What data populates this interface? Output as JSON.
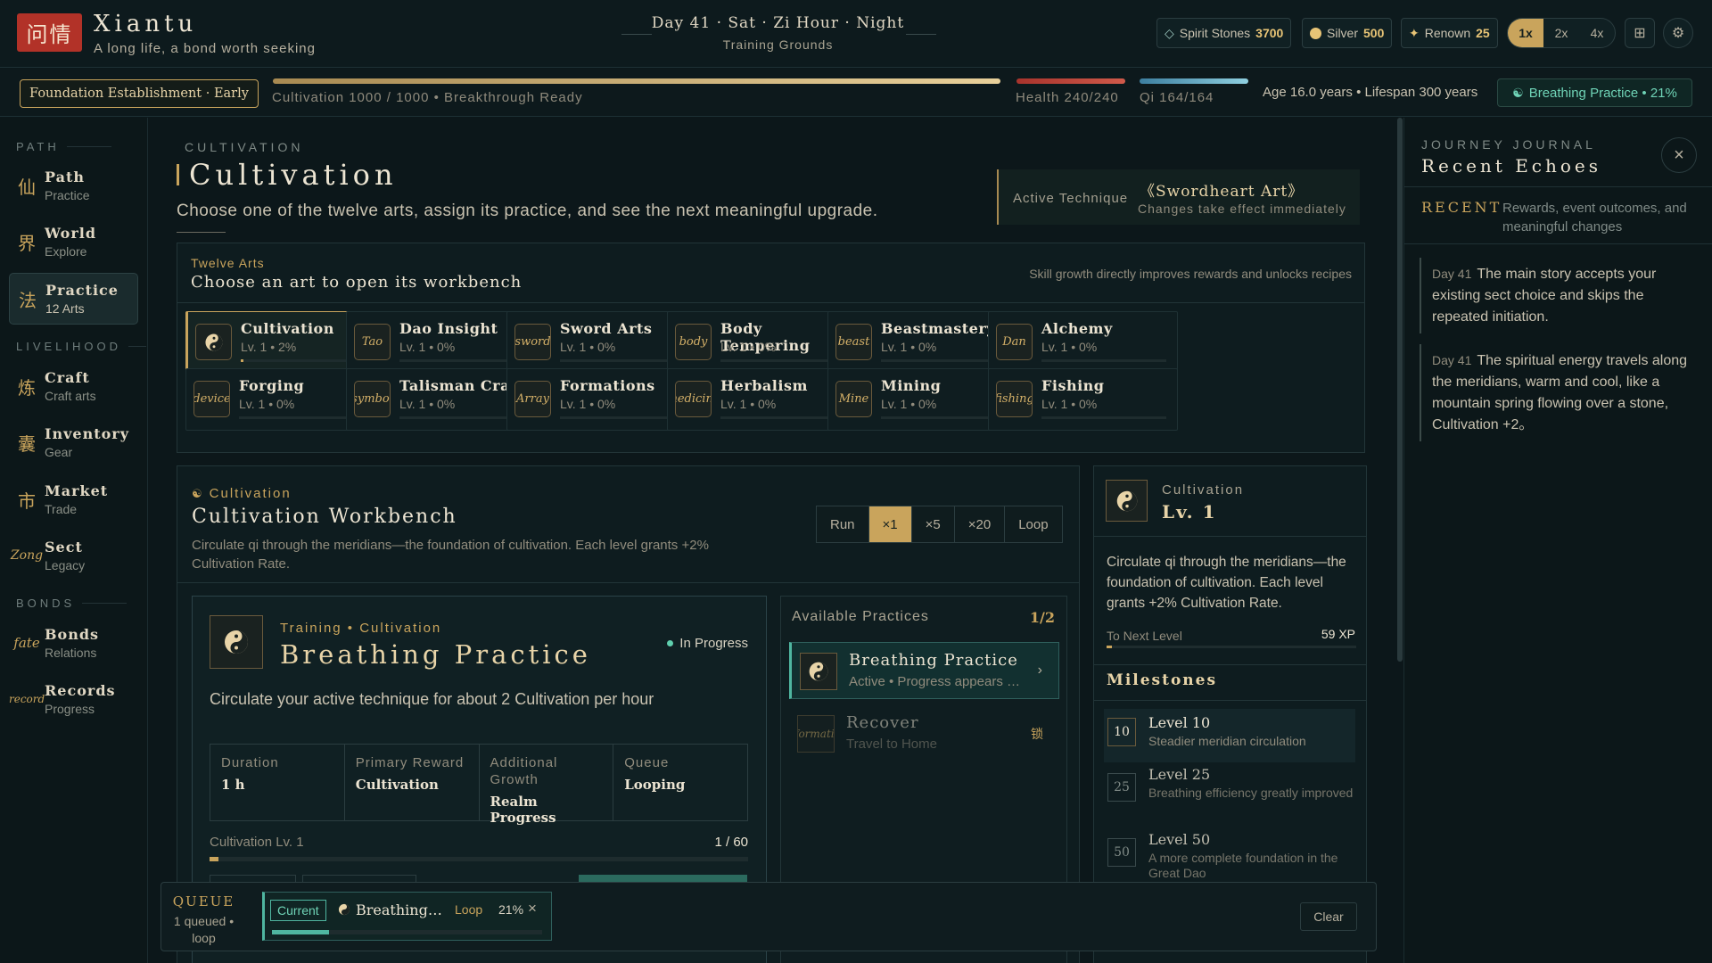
{
  "app": {
    "seal": "问情",
    "title": "Xiantu",
    "subtitle": "A long life, a bond worth seeking"
  },
  "datetime": {
    "main": "Day 41 · Sat · Zi Hour · Night",
    "location": "Training Grounds"
  },
  "resources": [
    {
      "icon": "diamond-icon",
      "label": "Spirit Stones",
      "value": "3700"
    },
    {
      "icon": "coin-icon",
      "label": "Silver",
      "value": "500"
    },
    {
      "icon": "star-icon",
      "label": "Renown",
      "value": "25"
    }
  ],
  "speed": {
    "options": [
      "1x",
      "2x",
      "4x"
    ],
    "selected": "1x"
  },
  "status": {
    "realm": "Foundation Establishment · Early",
    "cultivation_text": "Cultivation 1000 / 1000 • Breakthrough Ready",
    "cultivation_fraction": 1.0,
    "health_text": "Health 240/240",
    "health_fraction": 1.0,
    "qi_text": "Qi 164/164",
    "qi_fraction": 1.0,
    "age_text": "Age 16.0 years • Lifespan 300 years",
    "active_practice": "Breathing Practice • 21%"
  },
  "colors": {
    "accent": "#c9a45c",
    "qi": "#4fb6a0",
    "health": "#c9443a",
    "bg": "#0c171a"
  },
  "sidebar": {
    "sections": [
      "PATH",
      "LIVELIHOOD",
      "BONDS"
    ],
    "items": [
      {
        "glyph": "仙",
        "label": "Path",
        "sub": "Practice",
        "active": false
      },
      {
        "glyph": "界",
        "label": "World",
        "sub": "Explore",
        "active": false
      },
      {
        "glyph": "法",
        "label": "Practice",
        "sub": "12 Arts",
        "active": true
      },
      {
        "glyph": "炼",
        "label": "Craft",
        "sub": "Craft arts",
        "active": false
      },
      {
        "glyph": "囊",
        "label": "Inventory",
        "sub": "Gear",
        "active": false
      },
      {
        "glyph": "市",
        "label": "Market",
        "sub": "Trade",
        "active": false
      },
      {
        "glyph": "Zong",
        "label": "Sect",
        "sub": "Legacy",
        "active": false
      },
      {
        "glyph": "fate",
        "label": "Bonds",
        "sub": "Relations",
        "active": false
      },
      {
        "glyph": "record",
        "label": "Records",
        "sub": "Progress",
        "active": false
      }
    ]
  },
  "page": {
    "kicker": "CULTIVATION",
    "title": "Cultivation",
    "description": "Choose one of the twelve arts, assign its practice, and see the next meaningful upgrade.",
    "active_technique_label": "Active Technique",
    "active_technique_name": "《Swordheart Art》",
    "active_technique_note": "Changes take effect immediately"
  },
  "arts": {
    "kicker": "Twelve Arts",
    "title": "Choose an art to open its workbench",
    "hint": "Skill growth directly improves rewards and unlocks recipes",
    "items": [
      {
        "icon": "yin-yang",
        "name": "Cultivation",
        "level": "Lv. 1 • 2%",
        "progress": 0.02,
        "active": true
      },
      {
        "icon": "Tao",
        "name": "Dao Insight",
        "level": "Lv. 1 • 0%",
        "progress": 0,
        "active": false
      },
      {
        "icon": "sword",
        "name": "Sword Arts",
        "level": "Lv. 1 • 0%",
        "progress": 0,
        "active": false
      },
      {
        "icon": "body",
        "name": "Body Tempering",
        "level": "Lv. 1 • 0%",
        "progress": 0,
        "active": false
      },
      {
        "icon": "beast",
        "name": "Beastmastery",
        "level": "Lv. 1 • 0%",
        "progress": 0,
        "active": false
      },
      {
        "icon": "Dan",
        "name": "Alchemy",
        "level": "Lv. 1 • 0%",
        "progress": 0,
        "active": false
      },
      {
        "icon": "device",
        "name": "Forging",
        "level": "Lv. 1 • 0%",
        "progress": 0,
        "active": false
      },
      {
        "icon": "symbol",
        "name": "Talisman Craft",
        "level": "Lv. 1 • 0%",
        "progress": 0,
        "active": false
      },
      {
        "icon": "Array",
        "name": "Formations",
        "level": "Lv. 1 • 0%",
        "progress": 0,
        "active": false
      },
      {
        "icon": "medicine",
        "name": "Herbalism",
        "level": "Lv. 1 • 0%",
        "progress": 0,
        "active": false
      },
      {
        "icon": "Mine",
        "name": "Mining",
        "level": "Lv. 1 • 0%",
        "progress": 0,
        "active": false
      },
      {
        "icon": "fishing",
        "name": "Fishing",
        "level": "Lv. 1 • 0%",
        "progress": 0,
        "active": false
      }
    ]
  },
  "workbench": {
    "kicker": "Cultivation",
    "title": "Cultivation Workbench",
    "description": "Circulate qi through the meridians—the foundation of cultivation. Each level grants +2% Cultivation Rate.",
    "run_label": "Run",
    "run_options": [
      "×1",
      "×5",
      "×20",
      "Loop"
    ],
    "run_selected": "×1",
    "detail": {
      "kicker": "Training • Cultivation",
      "title": "Breathing Practice",
      "status": "In Progress",
      "description": "Circulate your active technique for about 2 Cultivation per hour",
      "stats": [
        {
          "label": "Duration",
          "value": "1 h"
        },
        {
          "label": "Primary Reward",
          "value": "Cultivation"
        },
        {
          "label": "Additional Growth",
          "value": "Realm Progress"
        },
        {
          "label": "Queue",
          "value": "Looping"
        }
      ],
      "progress_label": "Cultivation Lv. 1",
      "progress_value": "1 / 60",
      "progress_fraction": 0.0167
    },
    "available": {
      "title": "Available Practices",
      "count": "1/2",
      "items": [
        {
          "icon": "yin-yang",
          "name": "Breathing Practice",
          "sub": "Active • Progress appears here",
          "action": "›",
          "active": true
        },
        {
          "icon": "information",
          "name": "Recover",
          "sub": "Travel to Home",
          "action": "锁",
          "active": false
        }
      ]
    }
  },
  "info": {
    "kicker": "Cultivation",
    "level": "Lv. 1",
    "description": "Circulate qi through the meridians—the foundation of cultivation. Each level grants +2% Cultivation Rate.",
    "next_label": "To Next Level",
    "next_value": "59 XP",
    "next_fraction": 0.02,
    "milestones_title": "Milestones",
    "milestones": [
      {
        "level": "10",
        "title": "Level 10",
        "desc": "Steadier meridian circulation",
        "highlight": true
      },
      {
        "level": "25",
        "title": "Level 25",
        "desc": "Breathing efficiency greatly improved",
        "highlight": false
      },
      {
        "level": "50",
        "title": "Level 50",
        "desc": "A more complete foundation in the Great Dao",
        "highlight": false
      }
    ]
  },
  "journal": {
    "kicker": "JOURNEY JOURNAL",
    "title": "Recent Echoes",
    "recent_label": "RECENT",
    "recent_desc": "Rewards, event outcomes, and meaningful changes",
    "events": [
      {
        "day": "Day 41",
        "text": "The main story accepts your existing sect choice and skips the repeated initiation."
      },
      {
        "day": "Day 41",
        "text": "The spiritual energy travels along the meridians, warm and cool, like a mountain spring flowing over a stone, Cultivation +2。"
      }
    ]
  },
  "queue": {
    "title": "QUEUE",
    "summary": "1 queued • loop",
    "current_label": "Current",
    "item_name": "Breathing Practice",
    "item_mode": "Loop",
    "item_progress": "21%",
    "item_fraction": 0.21,
    "clear_label": "Clear"
  }
}
